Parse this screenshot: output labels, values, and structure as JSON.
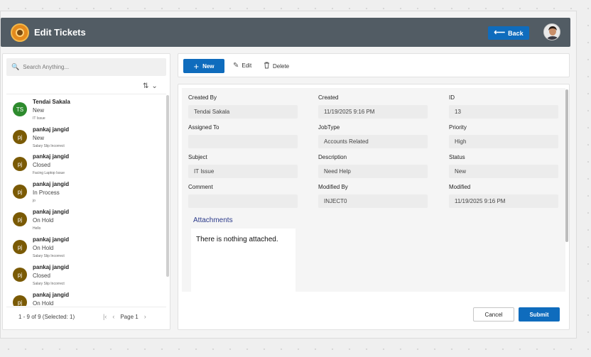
{
  "header": {
    "title": "Edit Tickets",
    "back_label": "Back"
  },
  "search": {
    "placeholder": "Search Anything..."
  },
  "tickets": [
    {
      "initials": "TS",
      "name": "Tendai Sakala",
      "status": "New",
      "subject": "IT Issue",
      "avatar_color": "#2e8b2e"
    },
    {
      "initials": "pj",
      "name": "pankaj jangid",
      "status": "New",
      "subject": "Salary Slip Incorrect",
      "avatar_color": "#7a5a05"
    },
    {
      "initials": "pj",
      "name": "pankaj jangid",
      "status": "Closed",
      "subject": "Facing Laptop Issue",
      "avatar_color": "#7a5a05"
    },
    {
      "initials": "pj",
      "name": "pankaj jangid",
      "status": "In Process",
      "subject": "jo",
      "avatar_color": "#7a5a05"
    },
    {
      "initials": "pj",
      "name": "pankaj jangid",
      "status": "On Hold",
      "subject": "Hello",
      "avatar_color": "#7a5a05"
    },
    {
      "initials": "pj",
      "name": "pankaj jangid",
      "status": "On Hold",
      "subject": "Salary Slip Incorrect",
      "avatar_color": "#7a5a05"
    },
    {
      "initials": "pj",
      "name": "pankaj jangid",
      "status": "Closed",
      "subject": "Salary Slip Incorrect",
      "avatar_color": "#7a5a05"
    },
    {
      "initials": "pj",
      "name": "pankaj jangid",
      "status": "On Hold",
      "subject": "",
      "avatar_color": "#7a5a05"
    }
  ],
  "pager": {
    "summary": "1 - 9 of 9 (Selected: 1)",
    "page_label": "Page 1"
  },
  "commands": {
    "new_label": "New",
    "edit_label": "Edit",
    "delete_label": "Delete"
  },
  "form": {
    "fields": [
      {
        "label": "Created By",
        "value": "Tendai Sakala"
      },
      {
        "label": "Created",
        "value": "11/19/2025 9:16 PM"
      },
      {
        "label": "ID",
        "value": "13"
      },
      {
        "label": "Assigned To",
        "value": ""
      },
      {
        "label": "JobType",
        "value": "Accounts Related"
      },
      {
        "label": "Priority",
        "value": "High"
      },
      {
        "label": "Subject",
        "value": "IT Issue"
      },
      {
        "label": "Description",
        "value": "Need Help"
      },
      {
        "label": "Status",
        "value": "New"
      },
      {
        "label": "Comment",
        "value": ""
      },
      {
        "label": "Modified By",
        "value": "INJECT0"
      },
      {
        "label": "Modified",
        "value": "11/19/2025 9:16 PM"
      }
    ],
    "attachments_title": "Attachments",
    "attachments_empty": "There is nothing attached.",
    "cancel_label": "Cancel",
    "submit_label": "Submit"
  },
  "colors": {
    "header_bg": "#525c64",
    "accent": "#0f6cbd"
  }
}
